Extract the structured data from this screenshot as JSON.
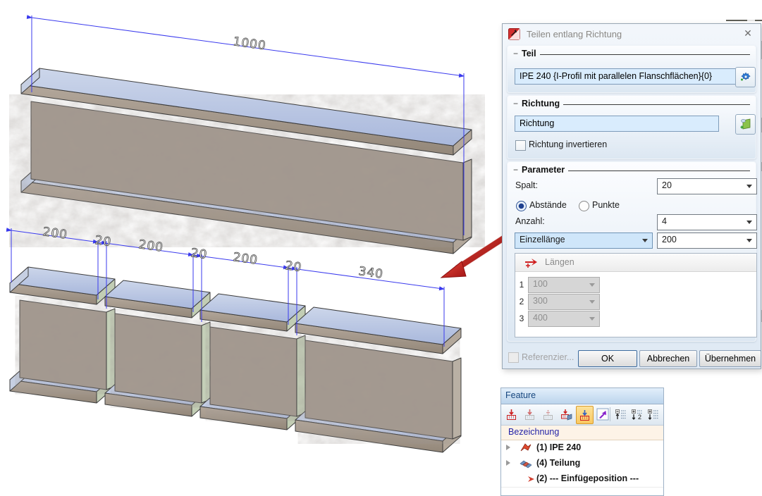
{
  "canvas": {
    "dim_total": "1000",
    "dims": [
      "200",
      "20",
      "200",
      "20",
      "200",
      "20",
      "340"
    ]
  },
  "dialog": {
    "title": "Teilen entlang Richtung",
    "teil": {
      "label": "Teil",
      "part_value": "IPE 240 {I-Profil mit parallelen Flanschflächen}{0}",
      "button_icon": "gear-plus-icon"
    },
    "richtung": {
      "label": "Richtung",
      "value": "Richtung",
      "button_icon": "pick-direction-icon",
      "invert_label": "Richtung invertieren"
    },
    "parameter": {
      "label": "Parameter",
      "spalt_label": "Spalt:",
      "spalt_value": "20",
      "abstaende_label": "Abstände",
      "punkte_label": "Punkte",
      "anzahl_label": "Anzahl:",
      "anzahl_value": "4",
      "mode_value": "Einzellänge",
      "einzellaenge_value": "200",
      "table": {
        "header": "Längen",
        "header_icon": "add-length-arrow-icon",
        "rows": [
          {
            "num": "1",
            "value": "100"
          },
          {
            "num": "2",
            "value": "300"
          },
          {
            "num": "3",
            "value": "400"
          }
        ]
      }
    },
    "footer": {
      "referenzieren_label": "Referenzier...",
      "ok": "OK",
      "cancel": "Abbrechen",
      "apply": "Übernehmen"
    }
  },
  "feature_panel": {
    "title": "Feature",
    "toolbar_icons": [
      "insert-feature-icon",
      "insert-feature-disabled-icon",
      "feature-list-disabled-icon",
      "feature-copy-icon",
      "feature-active-icon",
      "jump-insert-position-icon",
      "move-up-list-icon",
      "sort-numbered-list-icon",
      "move-down-list-icon"
    ],
    "header": "Bezeichnung",
    "rows": [
      {
        "icon": "profile-icon",
        "label": "(1) IPE 240"
      },
      {
        "icon": "division-icon",
        "label": "(4) Teilung"
      },
      {
        "icon": "insert-position-arrow-icon",
        "label": "(2) --- Einfügeposition ---"
      }
    ]
  },
  "colors": {
    "dimension_blue": "#3a3aee",
    "flange_blue": "#b9c6e2",
    "web_gray": "#a59a90",
    "annotation_red": "#c42222",
    "selection_orange": "#f9c860"
  }
}
